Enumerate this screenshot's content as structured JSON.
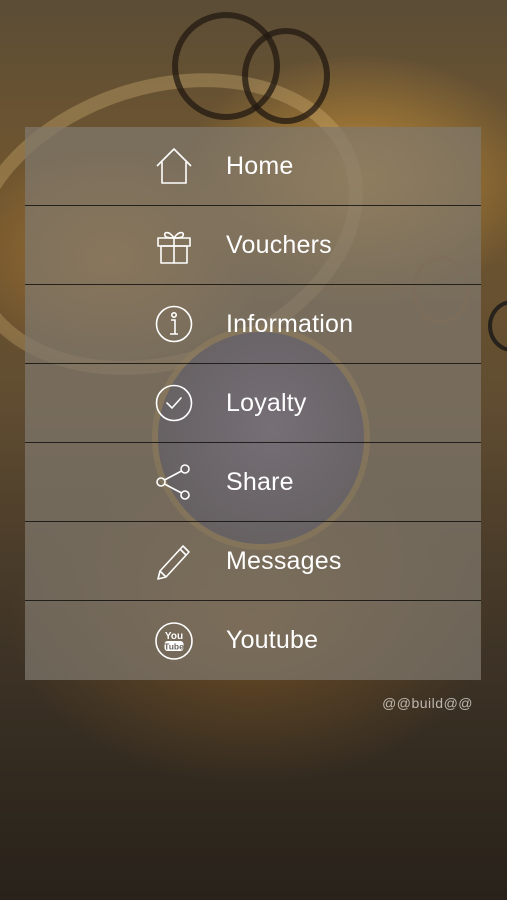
{
  "menu": {
    "items": [
      {
        "label": "Home",
        "icon": "home-icon"
      },
      {
        "label": "Vouchers",
        "icon": "gift-icon"
      },
      {
        "label": "Information",
        "icon": "info-icon"
      },
      {
        "label": "Loyalty",
        "icon": "check-circle-icon"
      },
      {
        "label": "Share",
        "icon": "share-icon"
      },
      {
        "label": "Messages",
        "icon": "pencil-icon"
      },
      {
        "label": "Youtube",
        "icon": "youtube-icon"
      }
    ]
  },
  "footer": {
    "build_tag": "@@build@@"
  },
  "colors": {
    "text": "#ffffff",
    "overlay": "#80786e",
    "divider": "#141210"
  }
}
